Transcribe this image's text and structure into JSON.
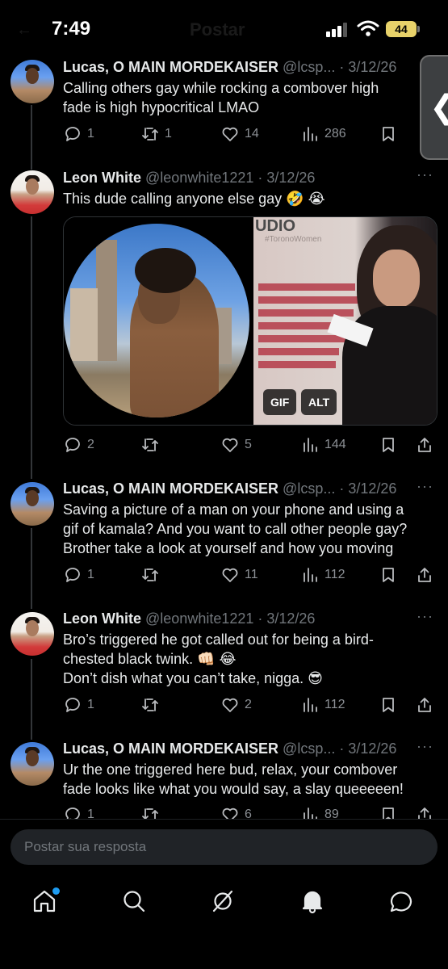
{
  "status_bar": {
    "time": "7:49",
    "battery": "44",
    "ghost_title": "Postar"
  },
  "tweets": [
    {
      "name": "Lucas, O MAIN MORDEKAISER",
      "handle": "@lcsp...",
      "date": "3/12/26",
      "text": [
        "Calling others gay while rocking a combover high",
        "fade is high hypocritical LMAO"
      ],
      "replies": "1",
      "reposts": "1",
      "likes": "14",
      "views": "286"
    },
    {
      "name": "Leon White",
      "handle": "@leonwhite1221",
      "date": "3/12/26",
      "text": [
        "This dude calling anyone else gay 🤣 😭"
      ],
      "replies": "2",
      "reposts": "",
      "likes": "5",
      "views": "144",
      "media": {
        "gif_label": "GIF",
        "alt_label": "ALT",
        "gif_studio": "UDIO",
        "gif_tag": "#ToronoWomen"
      }
    },
    {
      "name": "Lucas, O MAIN MORDEKAISER",
      "handle": "@lcsp...",
      "date": "3/12/26",
      "text": [
        "Saving a picture of a man on your phone and using a",
        "gif of kamala? And you want to call other people gay?",
        "Brother take a look at yourself and how you moving"
      ],
      "replies": "1",
      "reposts": "",
      "likes": "11",
      "views": "112"
    },
    {
      "name": "Leon White",
      "handle": "@leonwhite1221",
      "date": "3/12/26",
      "text": [
        "Bro’s triggered he got called out for being a bird-",
        "chested black twink. 👊🏻 😂",
        "Don’t dish what you can’t take, nigga. 😎"
      ],
      "replies": "1",
      "reposts": "",
      "likes": "2",
      "views": "112"
    },
    {
      "name": "Lucas, O MAIN MORDEKAISER",
      "handle": "@lcsp...",
      "date": "3/12/26",
      "text": [
        "Ur the one triggered here bud, relax, your combover",
        "fade looks like what you would say, a slay queeeeen!"
      ],
      "replies": "1",
      "reposts": "",
      "likes": "6",
      "views": "89"
    }
  ],
  "reply_box": {
    "placeholder": "Postar sua resposta"
  },
  "icons": [
    "back-chevron-icon",
    "reply-icon",
    "repost-icon",
    "like-icon",
    "views-icon",
    "bookmark-icon",
    "share-icon",
    "home-icon",
    "search-icon",
    "grok-icon",
    "notifications-icon",
    "messages-icon"
  ],
  "colors": {
    "background": "#000000",
    "text": "#e7e9ea",
    "muted": "#71767b",
    "accent": "#1d9bf0"
  }
}
